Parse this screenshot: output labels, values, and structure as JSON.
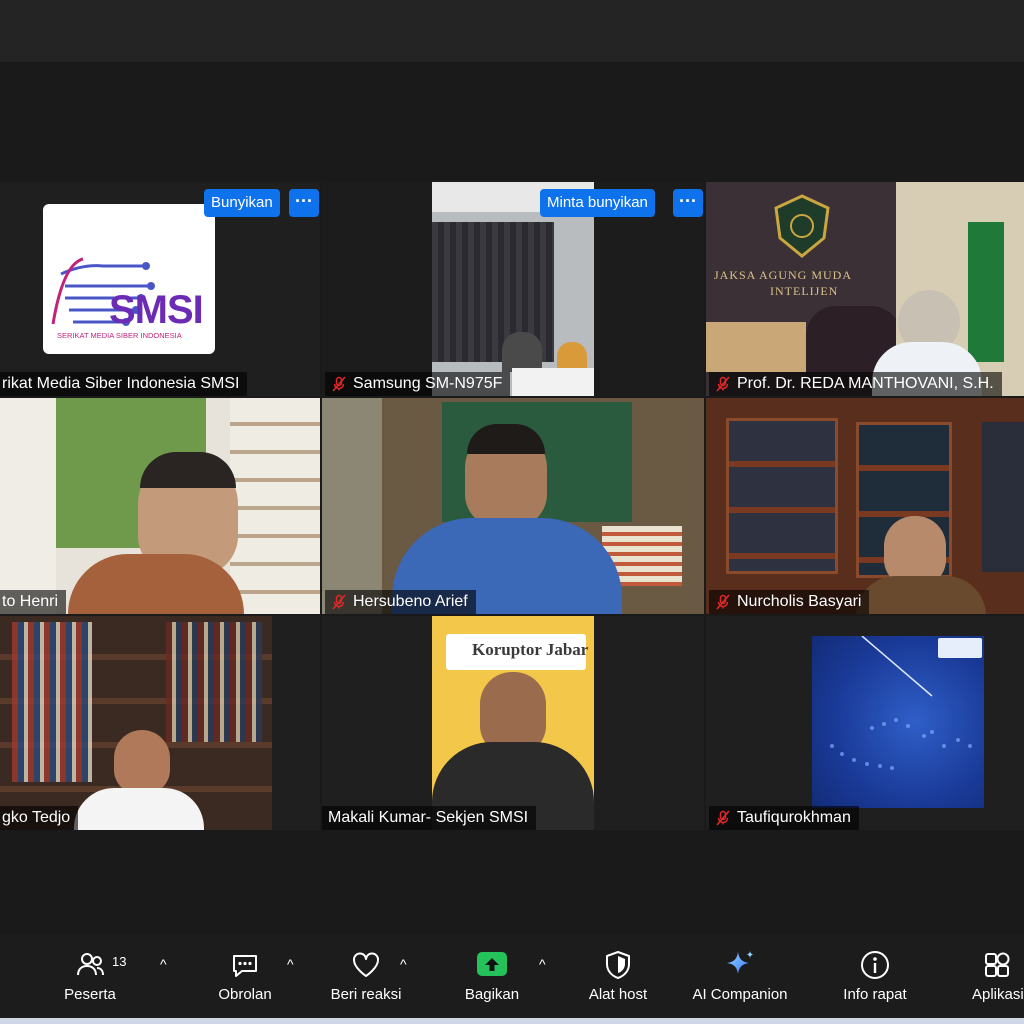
{
  "tiles": {
    "smsi": {
      "name": "rikat Media Siber Indonesia SMSI",
      "logo_text": "SMSI",
      "logo_sub": "SERIKAT MEDIA SIBER INDONESIA",
      "unmute": "Bunyikan",
      "more": "···"
    },
    "samsung": {
      "name": "Samsung SM-N975F",
      "ask_unmute": "Minta bunyikan",
      "more": "···"
    },
    "reda": {
      "name": "Prof. Dr. REDA MANTHOVANI, S.H.",
      "wall_text_1": "JAKSA AGUNG MUDA",
      "wall_text_2": "INTELIJEN"
    },
    "henri": {
      "name": "to Henri"
    },
    "hersubeno": {
      "name": "Hersubeno Arief"
    },
    "nurcholis": {
      "name": "Nurcholis Basyari"
    },
    "tedjo": {
      "name": "gko Tedjo"
    },
    "makali": {
      "name": "Makali Kumar- Sekjen SMSI",
      "banner": "Koruptor Jabar"
    },
    "taufiq": {
      "name": "Taufiqurokhman"
    }
  },
  "toolbar": {
    "participants": {
      "label": "Peserta",
      "count": "13"
    },
    "chat": {
      "label": "Obrolan"
    },
    "reactions": {
      "label": "Beri reaksi"
    },
    "share": {
      "label": "Bagikan"
    },
    "host_tools": {
      "label": "Alat host"
    },
    "ai": {
      "label": "AI Companion"
    },
    "info": {
      "label": "Info rapat"
    },
    "apps": {
      "label": "Aplikasi"
    },
    "caret": "^"
  },
  "colors": {
    "accent": "#0e72ed",
    "share_green": "#25c15a",
    "mic_red": "#e02828"
  }
}
